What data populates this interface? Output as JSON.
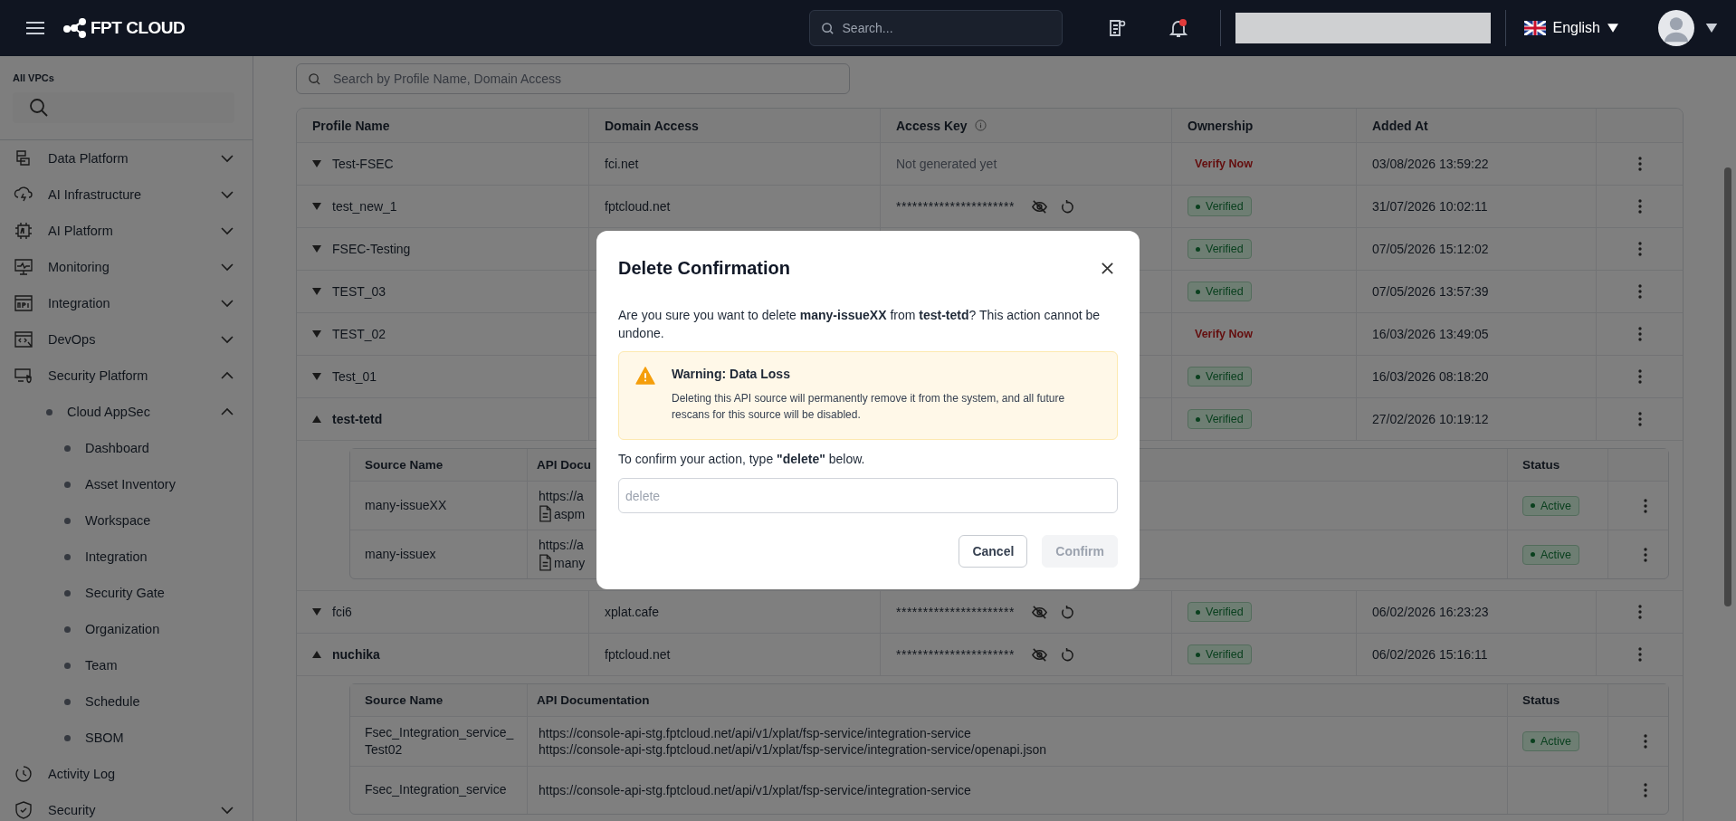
{
  "topbar": {
    "brand": "FPT CLOUD",
    "search": {
      "placeholder": "Search..."
    },
    "language": "English",
    "notification_dot": true
  },
  "sidebar": {
    "vpc_label": "All VPCs",
    "items": [
      {
        "label": "Data Platform",
        "expanded": false
      },
      {
        "label": "AI Infrastructure",
        "expanded": false
      },
      {
        "label": "AI Platform",
        "expanded": false
      },
      {
        "label": "Monitoring",
        "expanded": false
      },
      {
        "label": "Integration",
        "expanded": false
      },
      {
        "label": "DevOps",
        "expanded": false
      },
      {
        "label": "Security Platform",
        "expanded": true,
        "children": [
          {
            "label": "Cloud AppSec",
            "expanded": true,
            "children": [
              {
                "label": "Dashboard"
              },
              {
                "label": "Asset Inventory"
              },
              {
                "label": "Workspace"
              },
              {
                "label": "Integration"
              },
              {
                "label": "Security Gate"
              },
              {
                "label": "Organization"
              },
              {
                "label": "Team"
              },
              {
                "label": "Schedule"
              },
              {
                "label": "SBOM"
              }
            ]
          }
        ]
      },
      {
        "label": "Activity Log"
      },
      {
        "label": "Security",
        "expanded": false
      }
    ]
  },
  "main": {
    "search": {
      "placeholder": "Search by Profile Name, Domain Access"
    },
    "columns": [
      "Profile Name",
      "Domain Access",
      "Access Key",
      "Ownership",
      "Added At"
    ],
    "rows": [
      {
        "name": "Test-FSEC",
        "expanded": false,
        "domain": "fci.net",
        "access_key": {
          "kind": "none",
          "text": "Not generated yet"
        },
        "ownership": {
          "kind": "link",
          "text": "Verify Now"
        },
        "added_at": "03/08/2026 13:59:22"
      },
      {
        "name": "test_new_1",
        "expanded": false,
        "domain": "fptcloud.net",
        "access_key": {
          "kind": "masked",
          "text": "**********************"
        },
        "ownership": {
          "kind": "badge",
          "text": "Verified"
        },
        "added_at": "31/07/2026 10:02:11"
      },
      {
        "name": "FSEC-Testing",
        "expanded": false,
        "ownership": {
          "kind": "badge",
          "text": "Verified"
        },
        "added_at": "07/05/2026 15:12:02"
      },
      {
        "name": "TEST_03",
        "expanded": false,
        "ownership": {
          "kind": "badge",
          "text": "Verified"
        },
        "added_at": "07/05/2026 13:57:39"
      },
      {
        "name": "TEST_02",
        "expanded": false,
        "ownership": {
          "kind": "link",
          "text": "Verify Now"
        },
        "added_at": "16/03/2026 13:49:05"
      },
      {
        "name": "Test_01",
        "expanded": false,
        "ownership": {
          "kind": "badge",
          "text": "Verified"
        },
        "added_at": "16/03/2026 08:18:20"
      },
      {
        "name": "test-tetd",
        "expanded": true,
        "ownership": {
          "kind": "badge",
          "text": "Verified"
        },
        "added_at": "27/02/2026 10:19:12",
        "sources": {
          "columns": [
            "Source Name",
            "API Docu",
            "Status"
          ],
          "rows": [
            {
              "name": "many-issueXX",
              "docs": [
                {
                  "kind": "url",
                  "text": "https://a"
                },
                {
                  "kind": "file",
                  "text": "aspm"
                }
              ],
              "status": "Active"
            },
            {
              "name": "many-issuex",
              "docs": [
                {
                  "kind": "url",
                  "text": "https://a"
                },
                {
                  "kind": "file",
                  "text": "many"
                }
              ],
              "status": "Active"
            }
          ]
        }
      },
      {
        "name": "fci6",
        "expanded": false,
        "domain": "xplat.cafe",
        "access_key": {
          "kind": "masked",
          "text": "**********************"
        },
        "ownership": {
          "kind": "badge",
          "text": "Verified"
        },
        "added_at": "06/02/2026 16:23:23"
      },
      {
        "name": "nuchika",
        "expanded": true,
        "domain": "fptcloud.net",
        "access_key": {
          "kind": "masked",
          "text": "**********************"
        },
        "ownership": {
          "kind": "badge",
          "text": "Verified"
        },
        "added_at": "06/02/2026 15:16:11",
        "sources": {
          "columns": [
            "Source Name",
            "API Documentation",
            "Status"
          ],
          "rows": [
            {
              "name": "Fsec_Integration_service_Test02",
              "docs": [
                {
                  "kind": "url",
                  "text": "https://console-api-stg.fptcloud.net/api/v1/xplat/fsp-service/integration-service"
                },
                {
                  "kind": "url",
                  "text": "https://console-api-stg.fptcloud.net/api/v1/xplat/fsp-service/integration-service/openapi.json"
                }
              ],
              "status": "Active"
            },
            {
              "name": "Fsec_Integration_service",
              "docs": [
                {
                  "kind": "url",
                  "text": "https://console-api-stg.fptcloud.net/api/v1/xplat/fsp-service/integration-service"
                }
              ]
            }
          ]
        }
      }
    ]
  },
  "modal": {
    "title": "Delete Confirmation",
    "message": "Are you sure you want to delete **many-issueXX** from **test-tetd**? This action cannot be undone.",
    "warning": {
      "title": "Warning: Data Loss",
      "text": "Deleting this API source will permanently remove it from the system, and all future rescans for this source will be disabled."
    },
    "prompt": "To confirm your action, type **\"delete\"** below.",
    "input": {
      "placeholder": "delete"
    },
    "buttons": [
      {
        "label": "Cancel",
        "disabled": false
      },
      {
        "label": "Confirm",
        "disabled": true
      }
    ]
  }
}
